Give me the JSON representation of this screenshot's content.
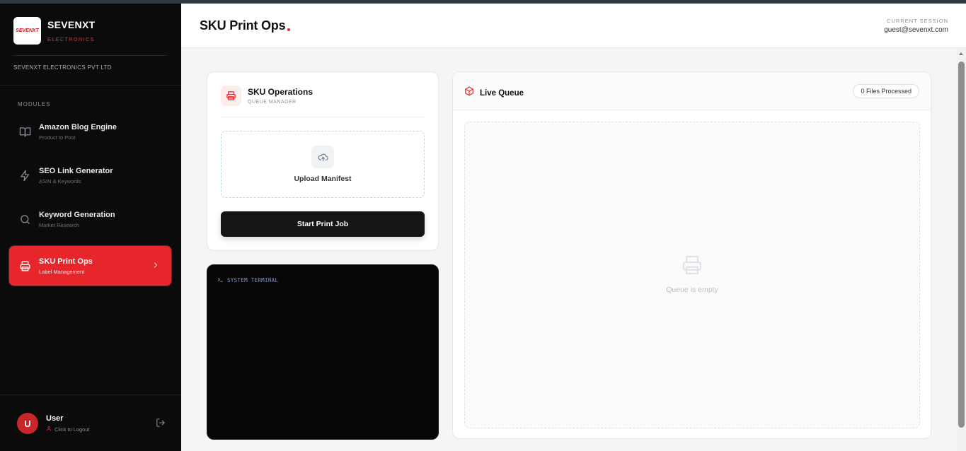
{
  "brand": {
    "logo_text": "SEVENXT",
    "name": "SEVENXT",
    "subtitle": "ELECTRONICS",
    "company": "SEVENXT ELECTRONICS PVT LTD"
  },
  "sidebar": {
    "section_label": "MODULES",
    "items": [
      {
        "label": "Amazon Blog Engine",
        "sub": "Product to Post",
        "icon": "book-icon"
      },
      {
        "label": "SEO Link Generator",
        "sub": "ASIN & Keywords",
        "icon": "lightning-icon"
      },
      {
        "label": "Keyword Generation",
        "sub": "Market Research",
        "icon": "search-icon"
      },
      {
        "label": "SKU Print Ops",
        "sub": "Label Management",
        "icon": "printer-icon",
        "active": true
      }
    ]
  },
  "user": {
    "initial": "U",
    "name": "User",
    "logout_hint": "Click to Logout"
  },
  "header": {
    "title": "SKU Print Ops",
    "session_label": "CURRENT SESSION",
    "session_email": "guest@sevenxt.com"
  },
  "operations": {
    "title": "SKU Operations",
    "subtitle": "QUEUE MANAGER",
    "upload_label": "Upload Manifest",
    "start_button": "Start Print Job"
  },
  "terminal": {
    "label": "SYSTEM TERMINAL"
  },
  "queue": {
    "title": "Live Queue",
    "files_badge": "0 Files Processed",
    "empty_text": "Queue is empty"
  },
  "colors": {
    "accent": "#e6262b",
    "sidebar_bg": "#0b0b0b",
    "terminal_bg": "#070707"
  }
}
